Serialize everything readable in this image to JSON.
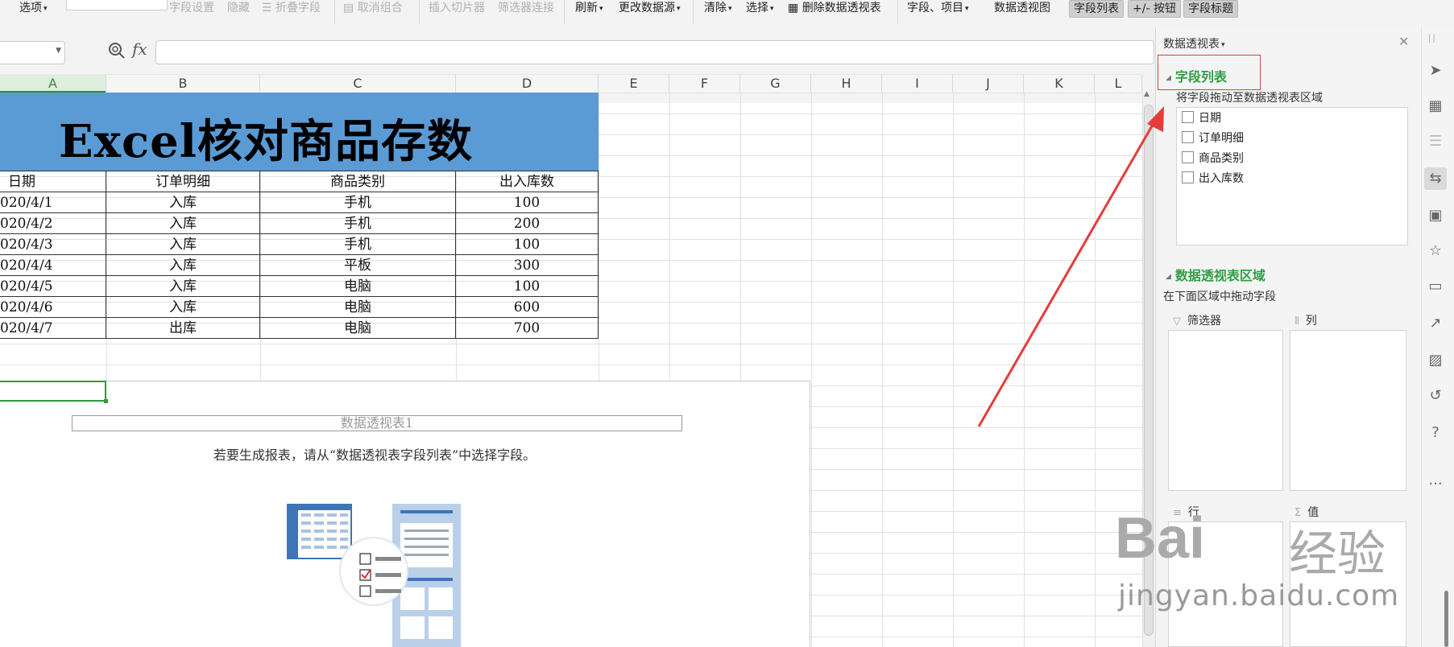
{
  "ribbon": {
    "options": "选项",
    "field_settings": "字段设置",
    "hide": "隐藏",
    "collapse_field": "折叠字段",
    "ungroup": "取消组合",
    "insert_slicer": "插入切片器",
    "filter_connection": "筛选器连接",
    "refresh": "刷新",
    "change_source": "更改数据源",
    "clear": "清除",
    "select": "选择",
    "delete_pivot": "删除数据透视表",
    "fields_items": "字段、项目",
    "pivot_chart": "数据透视图",
    "field_list": "字段列表",
    "plus_minus_button": "+/- 按钮",
    "field_header": "字段标题"
  },
  "formula_bar": {
    "fx": "fx",
    "name_box_value": "",
    "formula_value": ""
  },
  "columns": [
    "A",
    "B",
    "C",
    "D",
    "E",
    "F",
    "G",
    "H",
    "I",
    "J",
    "K",
    "L"
  ],
  "sheet": {
    "title": "Excel核对商品存数",
    "headers": [
      "日期",
      "订单明细",
      "商品类别",
      "出入库数"
    ],
    "rows": [
      [
        "020/4/1",
        "入库",
        "手机",
        "100"
      ],
      [
        "020/4/2",
        "入库",
        "手机",
        "200"
      ],
      [
        "020/4/3",
        "入库",
        "手机",
        "100"
      ],
      [
        "020/4/4",
        "入库",
        "平板",
        "300"
      ],
      [
        "020/4/5",
        "入库",
        "电脑",
        "100"
      ],
      [
        "020/4/6",
        "入库",
        "电脑",
        "600"
      ],
      [
        "020/4/7",
        "出库",
        "电脑",
        "700"
      ]
    ]
  },
  "pivot_placeholder": {
    "title": "数据透视表1",
    "hint": "若要生成报表，请从“数据透视表字段列表”中选择字段。"
  },
  "panel": {
    "title": "数据透视表",
    "field_list_header": "字段列表",
    "field_list_hint": "将字段拖动至数据透视表区域",
    "fields": [
      "日期",
      "订单明细",
      "商品类别",
      "出入库数"
    ],
    "areas_header": "数据透视表区域",
    "areas_hint": "在下面区域中拖动字段",
    "areas": {
      "filter": "筛选器",
      "columns": "列",
      "rows": "行",
      "values": "值"
    }
  },
  "watermark": {
    "logo": "Bai",
    "logo_cn": "经验",
    "url": "jingyan.baidu.com"
  },
  "colors": {
    "accent_green": "#2f9e44",
    "title_fill": "#5b9bd5",
    "annotation_red": "#e83b3b"
  }
}
